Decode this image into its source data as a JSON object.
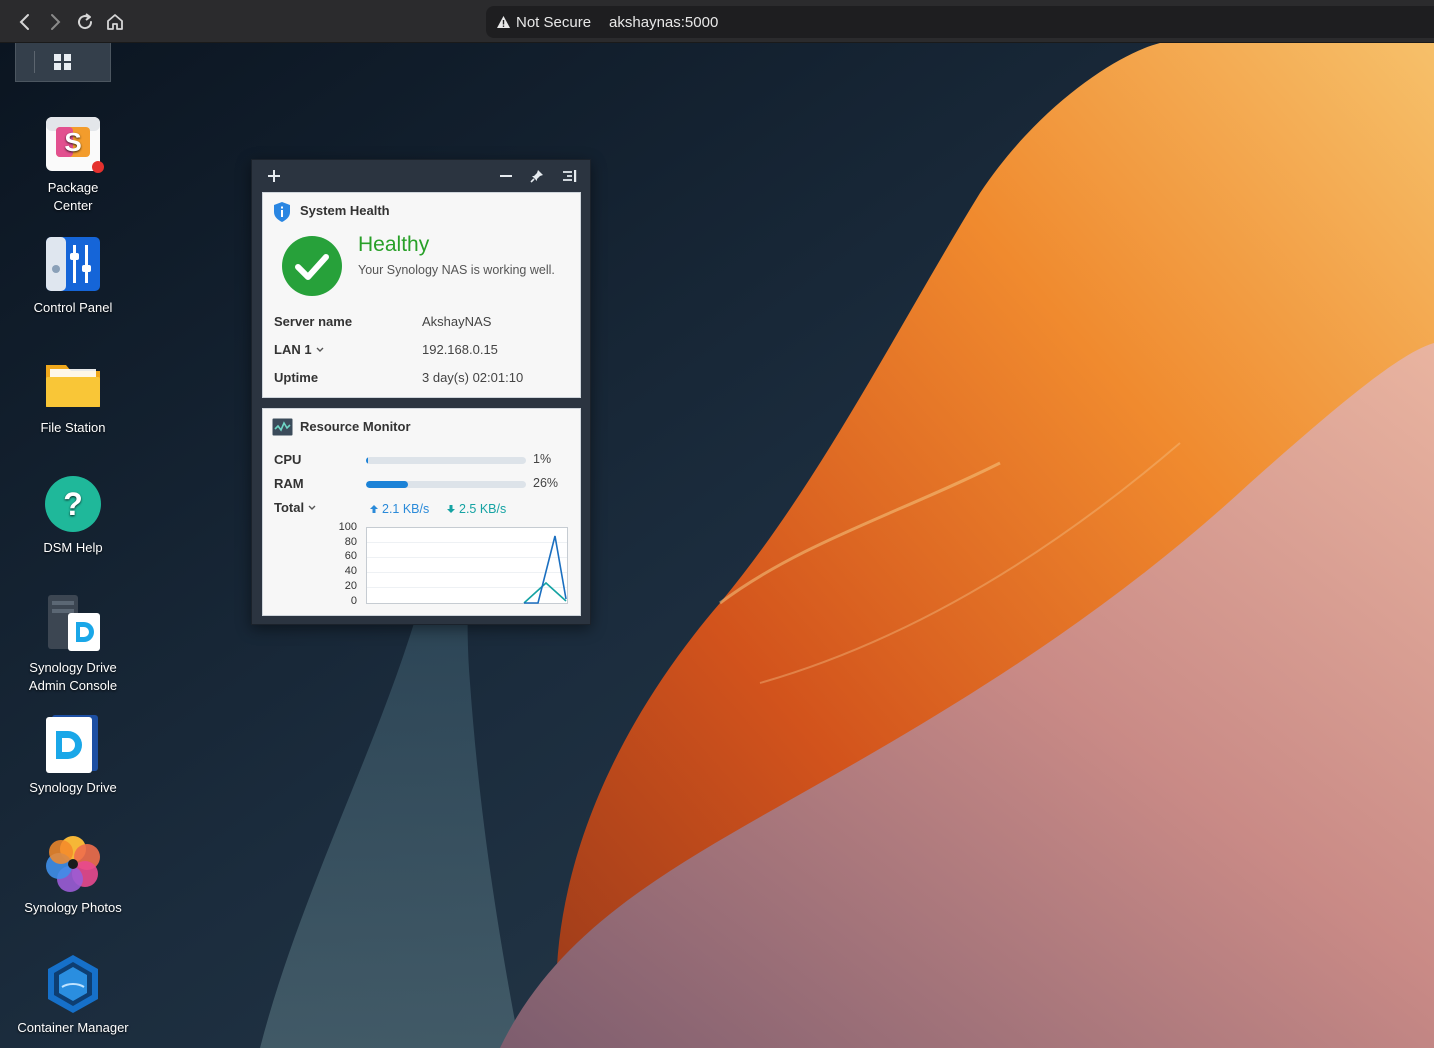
{
  "browser": {
    "security_label": "Not Secure",
    "url": "akshaynas:5000"
  },
  "desktop": {
    "apps": [
      {
        "label_lines": [
          "Package",
          "Center"
        ],
        "icon": "package-center-icon"
      },
      {
        "label_lines": [
          "Control Panel"
        ],
        "icon": "control-panel-icon"
      },
      {
        "label_lines": [
          "File Station"
        ],
        "icon": "file-station-icon"
      },
      {
        "label_lines": [
          "DSM Help"
        ],
        "icon": "dsm-help-icon"
      },
      {
        "label_lines": [
          "Synology Drive",
          "Admin Console"
        ],
        "icon": "synology-drive-admin-icon"
      },
      {
        "label_lines": [
          "Synology Drive"
        ],
        "icon": "synology-drive-icon"
      },
      {
        "label_lines": [
          "Synology Photos"
        ],
        "icon": "synology-photos-icon"
      },
      {
        "label_lines": [
          "Container Manager"
        ],
        "icon": "container-manager-icon"
      }
    ]
  },
  "widgets": {
    "system_health": {
      "title": "System Health",
      "status": "Healthy",
      "description": "Your Synology NAS is working well.",
      "rows": [
        {
          "label": "Server name",
          "value": "AkshayNAS"
        },
        {
          "label": "LAN 1",
          "value": "192.168.0.15"
        },
        {
          "label": "Uptime",
          "value": "3 day(s) 02:01:10"
        }
      ]
    },
    "resource_monitor": {
      "title": "Resource Monitor",
      "cpu": {
        "label": "CPU",
        "percent": 1,
        "text": "1%"
      },
      "ram": {
        "label": "RAM",
        "percent": 26,
        "text": "26%"
      },
      "network": {
        "label": "Total",
        "upload": "2.1 KB/s",
        "download": "2.5 KB/s"
      },
      "chart_y_ticks": [
        "100",
        "80",
        "60",
        "40",
        "20",
        "0"
      ]
    }
  },
  "colors": {
    "healthy_green": "#28a028",
    "accent_blue": "#1b82d7",
    "download_teal": "#15a3a3"
  }
}
